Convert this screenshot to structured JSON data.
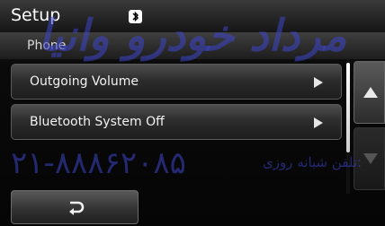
{
  "header": {
    "title": "Setup",
    "status_icon": "bluetooth-icon"
  },
  "subheader": {
    "title": "Phone"
  },
  "menu": {
    "items": [
      {
        "label": "Outgoing Volume",
        "icon": "chevron-right-icon"
      },
      {
        "label": "Bluetooth System Off",
        "icon": "chevron-right-icon"
      }
    ]
  },
  "scroll": {
    "up_icon": "arrow-up-icon",
    "down_icon": "arrow-down-icon"
  },
  "footer": {
    "back_icon": "back-arrow-icon"
  },
  "watermark": {
    "top_text": "مرداد خودرو وانیا",
    "phone": "۲۱-۸۸۸۶۲۰۸۵",
    "label": "تلفن شبانه روزی:"
  },
  "colors": {
    "accent": "#ffffff",
    "watermark": "#3c46c8",
    "background": "#000000"
  }
}
